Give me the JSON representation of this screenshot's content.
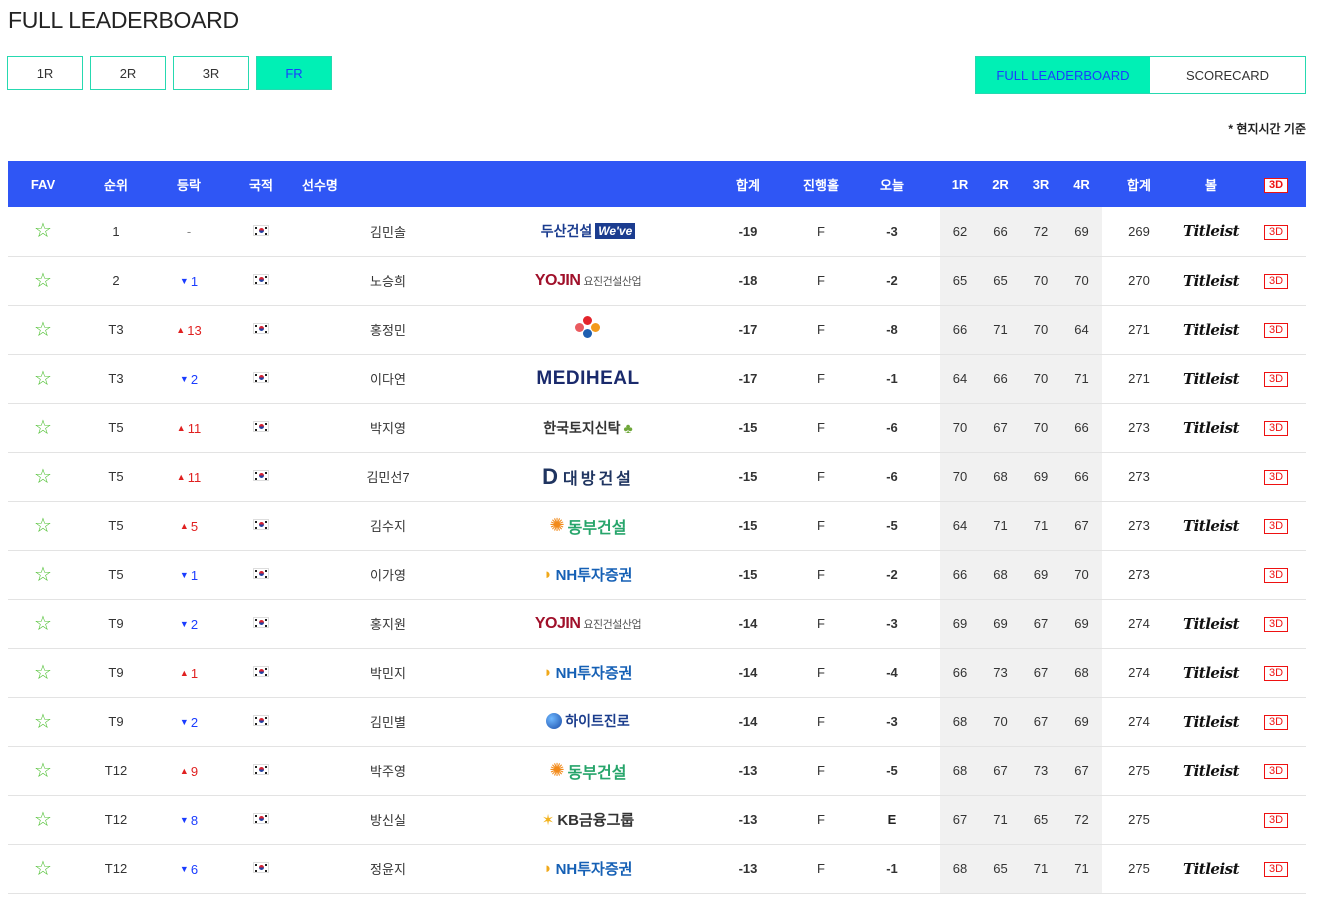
{
  "page_title": "FULL LEADERBOARD",
  "round_tabs": [
    {
      "label": "1R",
      "active": false
    },
    {
      "label": "2R",
      "active": false
    },
    {
      "label": "3R",
      "active": false
    },
    {
      "label": "FR",
      "active": true
    }
  ],
  "view_tabs": [
    {
      "label": "FULL LEADERBOARD",
      "active": true
    },
    {
      "label": "SCORECARD",
      "active": false
    }
  ],
  "note": "* 현지시간 기준",
  "colors": {
    "header_bg": "#2f56f5",
    "accent_mint": "#00f0b5",
    "score_orange": "#f06b28",
    "up_red": "#e02020",
    "down_blue": "#1a3cff",
    "fav_star": "#4cbf2f"
  },
  "columns": [
    "FAV",
    "순위",
    "등락",
    "국적",
    "선수명",
    "",
    "합계",
    "진행홀",
    "오늘",
    "1R",
    "2R",
    "3R",
    "4R",
    "합계",
    "볼",
    "3D"
  ],
  "rows": [
    {
      "rank": "1",
      "move_dir": "none",
      "move": "-",
      "country": "KOR",
      "name": "김민솔",
      "sponsor": "doosan",
      "sponsor_text": "두산건설",
      "sponsor_badge": "We've",
      "total": "-19",
      "hole": "F",
      "today": "-3",
      "r1": "62",
      "r2": "66",
      "r3": "72",
      "r4": "69",
      "strokes": "269",
      "ball": "Titleist",
      "threed": "3D"
    },
    {
      "rank": "2",
      "move_dir": "down",
      "move": "1",
      "country": "KOR",
      "name": "노승희",
      "sponsor": "yojin",
      "sponsor_text": "YOJIN",
      "sponsor_badge": "요진건설산업",
      "total": "-18",
      "hole": "F",
      "today": "-2",
      "r1": "65",
      "r2": "65",
      "r3": "70",
      "r4": "70",
      "strokes": "270",
      "ball": "Titleist",
      "threed": "3D"
    },
    {
      "rank": "T3",
      "move_dir": "up",
      "move": "13",
      "country": "KOR",
      "name": "홍정민",
      "sponsor": "cj",
      "sponsor_text": "CJ",
      "sponsor_badge": "",
      "total": "-17",
      "hole": "F",
      "today": "-8",
      "r1": "66",
      "r2": "71",
      "r3": "70",
      "r4": "64",
      "strokes": "271",
      "ball": "Titleist",
      "threed": "3D"
    },
    {
      "rank": "T3",
      "move_dir": "down",
      "move": "2",
      "country": "KOR",
      "name": "이다연",
      "sponsor": "mediheal",
      "sponsor_text": "MEDIHEAL",
      "sponsor_badge": "",
      "total": "-17",
      "hole": "F",
      "today": "-1",
      "r1": "64",
      "r2": "66",
      "r3": "70",
      "r4": "71",
      "strokes": "271",
      "ball": "Titleist",
      "threed": "3D"
    },
    {
      "rank": "T5",
      "move_dir": "up",
      "move": "11",
      "country": "KOR",
      "name": "박지영",
      "sponsor": "lh",
      "sponsor_text": "한국토지신탁",
      "sponsor_badge": "",
      "total": "-15",
      "hole": "F",
      "today": "-6",
      "r1": "70",
      "r2": "67",
      "r3": "70",
      "r4": "66",
      "strokes": "273",
      "ball": "Titleist",
      "threed": "3D"
    },
    {
      "rank": "T5",
      "move_dir": "up",
      "move": "11",
      "country": "KOR",
      "name": "김민선7",
      "sponsor": "daebang",
      "sponsor_text": "대방건설",
      "sponsor_badge": "D",
      "total": "-15",
      "hole": "F",
      "today": "-6",
      "r1": "70",
      "r2": "68",
      "r3": "69",
      "r4": "66",
      "strokes": "273",
      "ball": "",
      "threed": "3D"
    },
    {
      "rank": "T5",
      "move_dir": "up",
      "move": "5",
      "country": "KOR",
      "name": "김수지",
      "sponsor": "dongbu",
      "sponsor_text": "동부건설",
      "sponsor_badge": "",
      "total": "-15",
      "hole": "F",
      "today": "-5",
      "r1": "64",
      "r2": "71",
      "r3": "71",
      "r4": "67",
      "strokes": "273",
      "ball": "Titleist",
      "threed": "3D"
    },
    {
      "rank": "T5",
      "move_dir": "down",
      "move": "1",
      "country": "KOR",
      "name": "이가영",
      "sponsor": "nh",
      "sponsor_text": "NH투자증권",
      "sponsor_badge": "",
      "total": "-15",
      "hole": "F",
      "today": "-2",
      "r1": "66",
      "r2": "68",
      "r3": "69",
      "r4": "70",
      "strokes": "273",
      "ball": "",
      "threed": "3D"
    },
    {
      "rank": "T9",
      "move_dir": "down",
      "move": "2",
      "country": "KOR",
      "name": "홍지원",
      "sponsor": "yojin",
      "sponsor_text": "YOJIN",
      "sponsor_badge": "요진건설산업",
      "total": "-14",
      "hole": "F",
      "today": "-3",
      "r1": "69",
      "r2": "69",
      "r3": "67",
      "r4": "69",
      "strokes": "274",
      "ball": "Titleist",
      "threed": "3D"
    },
    {
      "rank": "T9",
      "move_dir": "up",
      "move": "1",
      "country": "KOR",
      "name": "박민지",
      "sponsor": "nh",
      "sponsor_text": "NH투자증권",
      "sponsor_badge": "",
      "total": "-14",
      "hole": "F",
      "today": "-4",
      "r1": "66",
      "r2": "73",
      "r3": "67",
      "r4": "68",
      "strokes": "274",
      "ball": "Titleist",
      "threed": "3D"
    },
    {
      "rank": "T9",
      "move_dir": "down",
      "move": "2",
      "country": "KOR",
      "name": "김민별",
      "sponsor": "hite",
      "sponsor_text": "하이트진로",
      "sponsor_badge": "",
      "total": "-14",
      "hole": "F",
      "today": "-3",
      "r1": "68",
      "r2": "70",
      "r3": "67",
      "r4": "69",
      "strokes": "274",
      "ball": "Titleist",
      "threed": "3D"
    },
    {
      "rank": "T12",
      "move_dir": "up",
      "move": "9",
      "country": "KOR",
      "name": "박주영",
      "sponsor": "dongbu",
      "sponsor_text": "동부건설",
      "sponsor_badge": "",
      "total": "-13",
      "hole": "F",
      "today": "-5",
      "r1": "68",
      "r2": "67",
      "r3": "73",
      "r4": "67",
      "strokes": "275",
      "ball": "Titleist",
      "threed": "3D"
    },
    {
      "rank": "T12",
      "move_dir": "down",
      "move": "8",
      "country": "KOR",
      "name": "방신실",
      "sponsor": "kb",
      "sponsor_text": "KB금융그룹",
      "sponsor_badge": "",
      "total": "-13",
      "hole": "F",
      "today": "E",
      "r1": "67",
      "r2": "71",
      "r3": "65",
      "r4": "72",
      "strokes": "275",
      "ball": "",
      "threed": "3D"
    },
    {
      "rank": "T12",
      "move_dir": "down",
      "move": "6",
      "country": "KOR",
      "name": "정윤지",
      "sponsor": "nh",
      "sponsor_text": "NH투자증권",
      "sponsor_badge": "",
      "total": "-13",
      "hole": "F",
      "today": "-1",
      "r1": "68",
      "r2": "65",
      "r3": "71",
      "r4": "71",
      "strokes": "275",
      "ball": "Titleist",
      "threed": "3D"
    }
  ]
}
